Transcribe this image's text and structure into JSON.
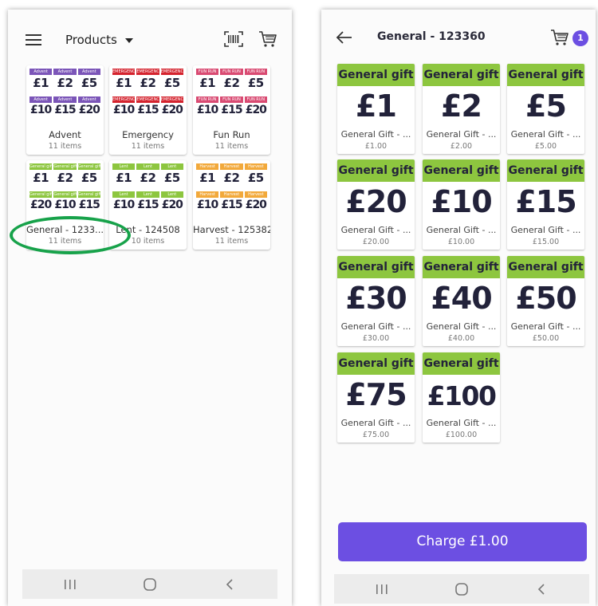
{
  "left": {
    "title": "Products",
    "categories": [
      {
        "name": "Advent",
        "count": "11 items",
        "tag": "Advent",
        "tag_color": "#7b55b8",
        "amounts": [
          "£1",
          "£2",
          "£5",
          "£10",
          "£15",
          "£20"
        ]
      },
      {
        "name": "Emergency",
        "count": "11 items",
        "tag": "EMERGENCY",
        "tag_color": "#d4232e",
        "amounts": [
          "£1",
          "£2",
          "£5",
          "£10",
          "£15",
          "£20"
        ]
      },
      {
        "name": "Fun Run",
        "count": "11 items",
        "tag": "FUN RUN",
        "tag_color": "#d94a72",
        "amounts": [
          "£1",
          "£2",
          "£5",
          "£10",
          "£15",
          "£20"
        ]
      },
      {
        "name": "General - 1233...",
        "count": "11 items",
        "tag": "General gift",
        "tag_color": "#8dc63f",
        "amounts": [
          "£1",
          "£2",
          "£5",
          "£20",
          "£10",
          "£15"
        ]
      },
      {
        "name": "Lent - 124508",
        "count": "10 items",
        "tag": "Lent",
        "tag_color": "#8dc63f",
        "amounts": [
          "£1",
          "£2",
          "£5",
          "£10",
          "£15",
          "£20"
        ]
      },
      {
        "name": "Harvest - 125382",
        "count": "11 items",
        "tag": "Harvest",
        "tag_color": "#f2a93b",
        "amounts": [
          "£1",
          "£2",
          "£5",
          "£10",
          "£15",
          "£20"
        ]
      }
    ],
    "highlight_color": "#17a24a"
  },
  "right": {
    "title": "General - 123360",
    "cart_count": "1",
    "band_label": "General gift",
    "products": [
      {
        "amount": "£1",
        "name": "General Gift - ...",
        "price": "£1.00"
      },
      {
        "amount": "£2",
        "name": "General Gift - ...",
        "price": "£2.00"
      },
      {
        "amount": "£5",
        "name": "General Gift - ...",
        "price": "£5.00"
      },
      {
        "amount": "£20",
        "name": "General Gift - ...",
        "price": "£20.00"
      },
      {
        "amount": "£10",
        "name": "General Gift - ...",
        "price": "£10.00"
      },
      {
        "amount": "£15",
        "name": "General Gift - ...",
        "price": "£15.00"
      },
      {
        "amount": "£30",
        "name": "General Gift - ...",
        "price": "£30.00"
      },
      {
        "amount": "£40",
        "name": "General Gift - ...",
        "price": "£40.00"
      },
      {
        "amount": "£50",
        "name": "General Gift - ...",
        "price": "£50.00"
      },
      {
        "amount": "£75",
        "name": "General Gift - ...",
        "price": "£75.00"
      },
      {
        "amount": "£100",
        "name": "General Gift - ...",
        "price": "£100.00"
      }
    ],
    "charge_label": "Charge £1.00",
    "band_color": "#8dc63f",
    "accent": "#6c4fe2"
  },
  "icons": {
    "menu": "menu-icon",
    "barcode": "barcode-scan-icon",
    "cart": "cart-icon",
    "back": "arrow-left-icon",
    "recent": "recent-apps-icon",
    "home": "home-icon",
    "nav_back": "chevron-left-icon"
  }
}
